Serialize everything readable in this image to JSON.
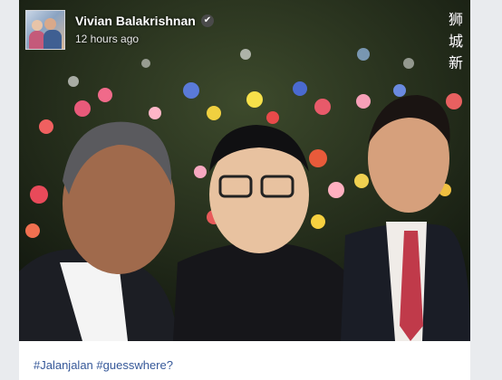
{
  "post": {
    "author": "Vivian Balakrishnan",
    "timestamp": "12 hours ago",
    "verified_icon": "verified-check-icon",
    "watermark": "狮城新",
    "hashtag1": "#Jalanjalan",
    "hashtag2": "#guesswhere?"
  },
  "colors": {
    "link": "#365899",
    "author_text": "#1d2129",
    "meta_text": "#616770",
    "page_bg": "#e9ebee"
  }
}
